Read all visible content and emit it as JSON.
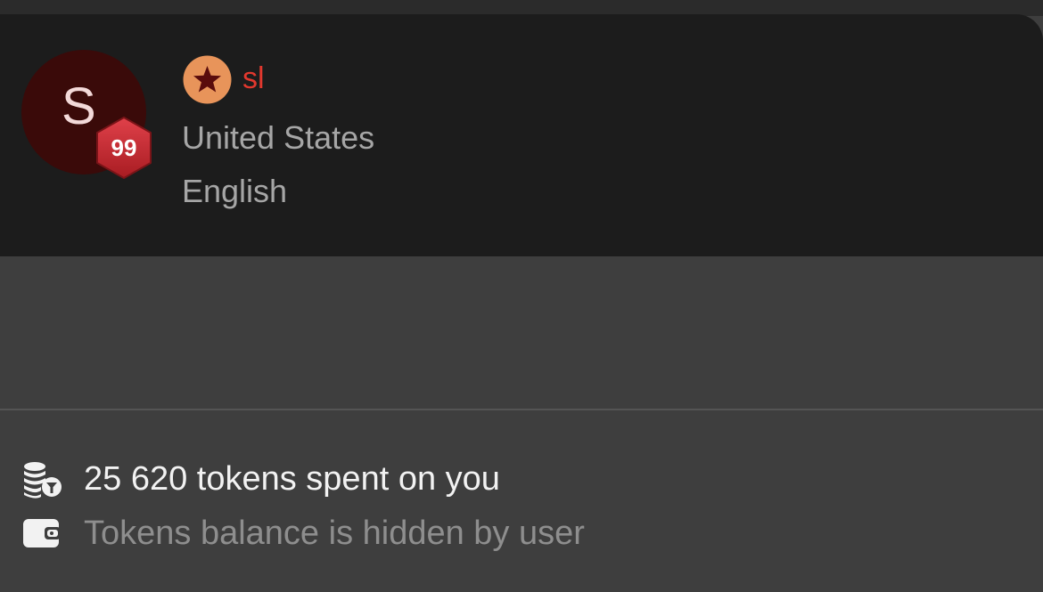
{
  "profile": {
    "avatar_letter": "S",
    "level": "99",
    "username": "sl",
    "country": "United States",
    "language": "English"
  },
  "stats": {
    "tokens_spent": "25 620 tokens spent on you",
    "balance_status": "Tokens balance is hidden by user"
  },
  "icons": {
    "rank": "star-rank-icon",
    "tokens": "coins-icon",
    "wallet": "wallet-icon"
  },
  "colors": {
    "card_background": "#1c1c1c",
    "page_background": "#3e3e3e",
    "username": "#e2382e",
    "avatar_background": "#3a0a09",
    "level_badge": "#c9262c",
    "rank_badge": "#e8945a",
    "secondary_text": "#a6a6a6",
    "muted_text": "#8e8e8e"
  }
}
